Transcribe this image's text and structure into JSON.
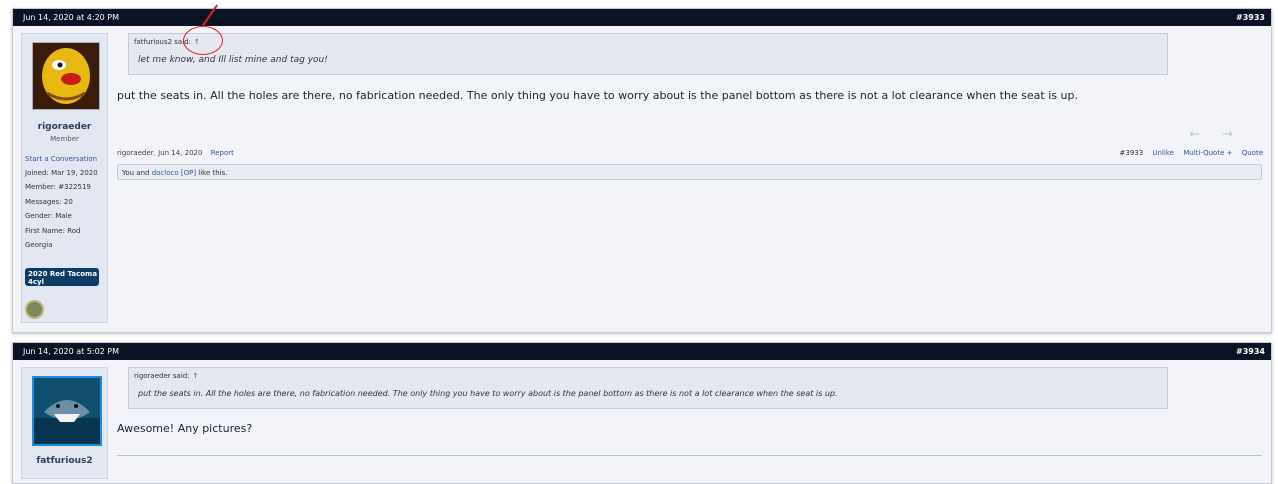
{
  "posts": [
    {
      "date": "Jun 14, 2020 at 4:20 PM",
      "number": "#3933",
      "user": {
        "name": "rigoraeder",
        "title": "Member",
        "start_conversation": "Start a Conversation",
        "joined_label": "Joined:",
        "joined": "Mar 19, 2020",
        "member_label": "Member:",
        "member": "#322519",
        "messages_label": "Messages:",
        "messages": "20",
        "gender_label": "Gender:",
        "gender": "Male",
        "first_name_label": "First Name:",
        "first_name": "Rod",
        "location": "Georgia",
        "vehicle": "2020 Red Tacoma 4cyl"
      },
      "quote": {
        "author_said": "fatfurious2 said:",
        "up_link": "↑",
        "text": "let me know, and Ill list mine and tag you!"
      },
      "message": "put the seats in. All the holes are there, no fabrication needed. The only thing you have to worry about is the panel bottom as there is not a lot clearance when the seat is up.",
      "footer": {
        "author": "rigoraeder",
        "date": "Jun 14, 2020",
        "report": "Report",
        "post_number": "#3933",
        "unlike": "Unlike",
        "multi_quote": "Multi-Quote +",
        "quote": "Quote"
      },
      "likes": {
        "prefix": "You and",
        "user": "docloco [OP]",
        "suffix": "like this."
      }
    },
    {
      "date": "Jun 14, 2020 at 5:02 PM",
      "number": "#3934",
      "user": {
        "name": "fatfurious2"
      },
      "quote": {
        "author_said": "rigoraeder said:",
        "up_link": "↑",
        "text": "put the seats in. All the holes are there, no fabrication needed. The only thing you have to worry about is the panel bottom as there is not a lot clearance when the seat is up."
      },
      "message": "Awesome! Any pictures?"
    }
  ],
  "icons": {
    "back": "arrow-left-icon",
    "forward": "arrow-right-icon"
  }
}
